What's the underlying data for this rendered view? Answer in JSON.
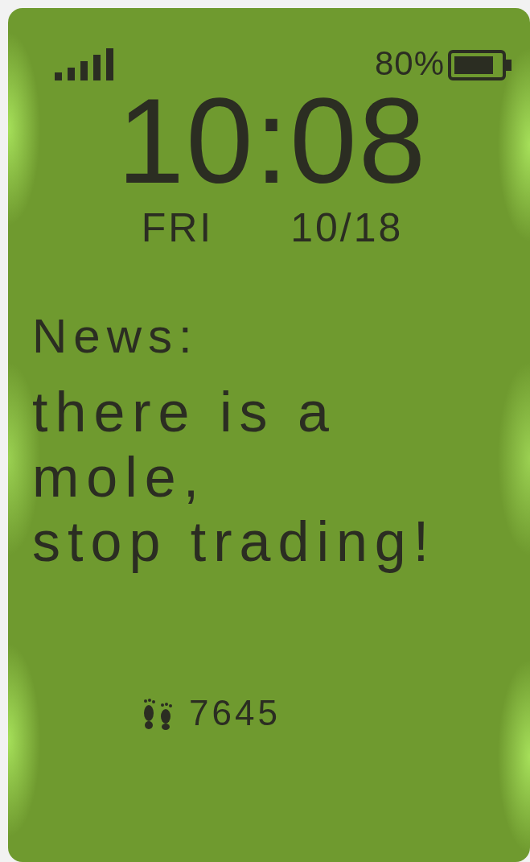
{
  "status_bar": {
    "battery_text": "80%"
  },
  "clock": {
    "time": "10:08",
    "day": "FRI",
    "date": "10/18"
  },
  "news": {
    "heading": "News:",
    "lines": [
      "there is a",
      "mole,",
      "stop trading!"
    ]
  },
  "steps": {
    "count": "7645"
  }
}
